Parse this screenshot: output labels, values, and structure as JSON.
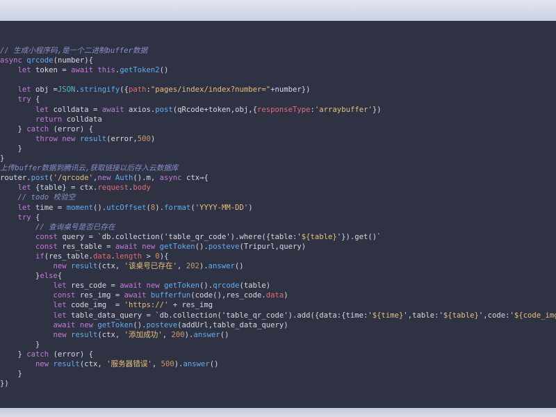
{
  "editor": {
    "language": "javascript",
    "colors": {
      "background": "#2f3242",
      "comment": "#8a90c8",
      "keyword": "#c678dd",
      "function": "#61afef",
      "string": "#e5c07b",
      "number": "#d19a66",
      "plain": "#d6d9e4",
      "property": "#e06c75",
      "type": "#56b6c2"
    },
    "lines": [
      [
        [
          "comment",
          "// 生成小程序码,是一个二进制buffer数据"
        ]
      ],
      [
        [
          "keyword",
          "async "
        ],
        [
          "fn",
          "qrcode"
        ],
        [
          "plain",
          "(number){"
        ]
      ],
      [
        [
          "plain",
          "    "
        ],
        [
          "keyword",
          "let "
        ],
        [
          "plain",
          "token = "
        ],
        [
          "keyword",
          "await "
        ],
        [
          "keyword",
          "this"
        ],
        [
          "plain",
          "."
        ],
        [
          "fn",
          "getToken2"
        ],
        [
          "plain",
          "()"
        ]
      ],
      [
        [
          "plain",
          ""
        ]
      ],
      [
        [
          "plain",
          "    "
        ],
        [
          "keyword",
          "let "
        ],
        [
          "plain",
          "obj ="
        ],
        [
          "type",
          "JSON"
        ],
        [
          "plain",
          "."
        ],
        [
          "fn",
          "stringify"
        ],
        [
          "plain",
          "({"
        ],
        [
          "prop",
          "path"
        ],
        [
          "plain",
          ":"
        ],
        [
          "string",
          "\"pages/index/index?number=\""
        ],
        [
          "plain",
          "+number})"
        ]
      ],
      [
        [
          "plain",
          "    "
        ],
        [
          "keyword",
          "try "
        ],
        [
          "plain",
          "{"
        ]
      ],
      [
        [
          "plain",
          "        "
        ],
        [
          "keyword",
          "let "
        ],
        [
          "plain",
          "colldata = "
        ],
        [
          "keyword",
          "await "
        ],
        [
          "plain",
          "axios."
        ],
        [
          "fn",
          "post"
        ],
        [
          "plain",
          "(qRcode+token,obj,{"
        ],
        [
          "prop",
          "responseType"
        ],
        [
          "plain",
          ":"
        ],
        [
          "string",
          "'arraybuffer'"
        ],
        [
          "plain",
          "})"
        ]
      ],
      [
        [
          "plain",
          "        "
        ],
        [
          "keyword",
          "return "
        ],
        [
          "plain",
          "colldata"
        ]
      ],
      [
        [
          "plain",
          "    } "
        ],
        [
          "keyword",
          "catch "
        ],
        [
          "plain",
          "(error) {"
        ]
      ],
      [
        [
          "plain",
          "        "
        ],
        [
          "keyword",
          "throw new "
        ],
        [
          "fn",
          "result"
        ],
        [
          "plain",
          "(error,"
        ],
        [
          "number",
          "500"
        ],
        [
          "plain",
          ")"
        ]
      ],
      [
        [
          "plain",
          "    }"
        ]
      ],
      [
        [
          "plain",
          "}"
        ]
      ],
      [
        [
          "comment",
          "上传buffer数据到腾讯云,获取链接以后存入云数据库"
        ]
      ],
      [
        [
          "plain",
          "router."
        ],
        [
          "fn",
          "post"
        ],
        [
          "plain",
          "("
        ],
        [
          "string",
          "'/qrcode'"
        ],
        [
          "plain",
          ","
        ],
        [
          "keyword",
          "new "
        ],
        [
          "fn",
          "Auth"
        ],
        [
          "plain",
          "().m, "
        ],
        [
          "keyword",
          "async "
        ],
        [
          "plain",
          "ctx⇒{"
        ]
      ],
      [
        [
          "plain",
          "    "
        ],
        [
          "keyword",
          "let "
        ],
        [
          "plain",
          "{table} = ctx."
        ],
        [
          "prop",
          "request"
        ],
        [
          "plain",
          "."
        ],
        [
          "prop",
          "body"
        ]
      ],
      [
        [
          "plain",
          "    "
        ],
        [
          "comment",
          "// todo 校验空"
        ]
      ],
      [
        [
          "plain",
          "    "
        ],
        [
          "keyword",
          "let "
        ],
        [
          "plain",
          "time = "
        ],
        [
          "fn",
          "moment"
        ],
        [
          "plain",
          "()."
        ],
        [
          "fn",
          "utcOffset"
        ],
        [
          "plain",
          "("
        ],
        [
          "number",
          "8"
        ],
        [
          "plain",
          ")."
        ],
        [
          "fn",
          "format"
        ],
        [
          "plain",
          "("
        ],
        [
          "string",
          "'YYYY-MM-DD'"
        ],
        [
          "plain",
          ")"
        ]
      ],
      [
        [
          "plain",
          "    "
        ],
        [
          "keyword",
          "try "
        ],
        [
          "plain",
          "{"
        ]
      ],
      [
        [
          "plain",
          "        "
        ],
        [
          "comment",
          "// 查询桌号是否已存在"
        ]
      ],
      [
        [
          "plain",
          "        "
        ],
        [
          "keyword",
          "const "
        ],
        [
          "plain",
          "query = `db.collection('table_qr_code').where({table:'"
        ],
        [
          "string",
          "${table}"
        ],
        [
          "plain",
          "'}).get()`"
        ]
      ],
      [
        [
          "plain",
          "        "
        ],
        [
          "keyword",
          "const "
        ],
        [
          "plain",
          "res_table = "
        ],
        [
          "keyword",
          "await new "
        ],
        [
          "fn",
          "getToken"
        ],
        [
          "plain",
          "()."
        ],
        [
          "fn",
          "posteve"
        ],
        [
          "plain",
          "(Tripurl,query)"
        ]
      ],
      [
        [
          "plain",
          "        "
        ],
        [
          "keyword",
          "if"
        ],
        [
          "plain",
          "(res_table."
        ],
        [
          "prop",
          "data"
        ],
        [
          "plain",
          "."
        ],
        [
          "prop",
          "length"
        ],
        [
          "plain",
          " > "
        ],
        [
          "number",
          "0"
        ],
        [
          "plain",
          ")"
        ],
        [
          "plain",
          "{"
        ]
      ],
      [
        [
          "plain",
          "            "
        ],
        [
          "keyword",
          "new "
        ],
        [
          "fn",
          "result"
        ],
        [
          "plain",
          "(ctx, "
        ],
        [
          "string",
          "'该桌号已存在'"
        ],
        [
          "plain",
          ", "
        ],
        [
          "number",
          "202"
        ],
        [
          "plain",
          ")."
        ],
        [
          "fn",
          "answer"
        ],
        [
          "plain",
          "()"
        ]
      ],
      [
        [
          "plain",
          "        }"
        ],
        [
          "keyword",
          "else"
        ],
        [
          "plain",
          "{"
        ]
      ],
      [
        [
          "plain",
          "            "
        ],
        [
          "keyword",
          "let "
        ],
        [
          "plain",
          "res_code = "
        ],
        [
          "keyword",
          "await new "
        ],
        [
          "fn",
          "getToken"
        ],
        [
          "plain",
          "()."
        ],
        [
          "fn",
          "qrcode"
        ],
        [
          "plain",
          "(table)"
        ]
      ],
      [
        [
          "plain",
          "            "
        ],
        [
          "keyword",
          "const "
        ],
        [
          "plain",
          "res_img = "
        ],
        [
          "keyword",
          "await "
        ],
        [
          "fn",
          "bufferfun"
        ],
        [
          "plain",
          "(code(),res_code."
        ],
        [
          "prop",
          "data"
        ],
        [
          "plain",
          ")"
        ]
      ],
      [
        [
          "plain",
          "            "
        ],
        [
          "keyword",
          "let "
        ],
        [
          "plain",
          "code_img  = "
        ],
        [
          "string",
          "'https://'"
        ],
        [
          "plain",
          " + res_img"
        ]
      ],
      [
        [
          "plain",
          "            "
        ],
        [
          "keyword",
          "let "
        ],
        [
          "plain",
          "table_data_query = `db.collection('table_qr_code').add({data:{time:'"
        ],
        [
          "string",
          "${time}"
        ],
        [
          "plain",
          "',table:'"
        ],
        [
          "string",
          "${table}"
        ],
        [
          "plain",
          "',code:'"
        ],
        [
          "string",
          "${code_img}"
        ]
      ],
      [
        [
          "plain",
          "            "
        ],
        [
          "keyword",
          "await new "
        ],
        [
          "fn",
          "getToken"
        ],
        [
          "plain",
          "()."
        ],
        [
          "fn",
          "posteve"
        ],
        [
          "plain",
          "(addUrl,table_data_query)"
        ]
      ],
      [
        [
          "plain",
          "            "
        ],
        [
          "keyword",
          "new "
        ],
        [
          "fn",
          "result"
        ],
        [
          "plain",
          "(ctx, "
        ],
        [
          "string",
          "'添加成功'"
        ],
        [
          "plain",
          ", "
        ],
        [
          "number",
          "200"
        ],
        [
          "plain",
          ")."
        ],
        [
          "fn",
          "answer"
        ],
        [
          "plain",
          "()"
        ]
      ],
      [
        [
          "plain",
          "        }"
        ]
      ],
      [
        [
          "plain",
          "    } "
        ],
        [
          "keyword",
          "catch "
        ],
        [
          "plain",
          "(error) {"
        ]
      ],
      [
        [
          "plain",
          "        "
        ],
        [
          "keyword",
          "new "
        ],
        [
          "fn",
          "result"
        ],
        [
          "plain",
          "(ctx, "
        ],
        [
          "string",
          "'服务器错误'"
        ],
        [
          "plain",
          ", "
        ],
        [
          "number",
          "500"
        ],
        [
          "plain",
          ")."
        ],
        [
          "fn",
          "answer"
        ],
        [
          "plain",
          "()"
        ]
      ],
      [
        [
          "plain",
          "    }"
        ]
      ],
      [
        [
          "plain",
          "})"
        ]
      ]
    ]
  }
}
